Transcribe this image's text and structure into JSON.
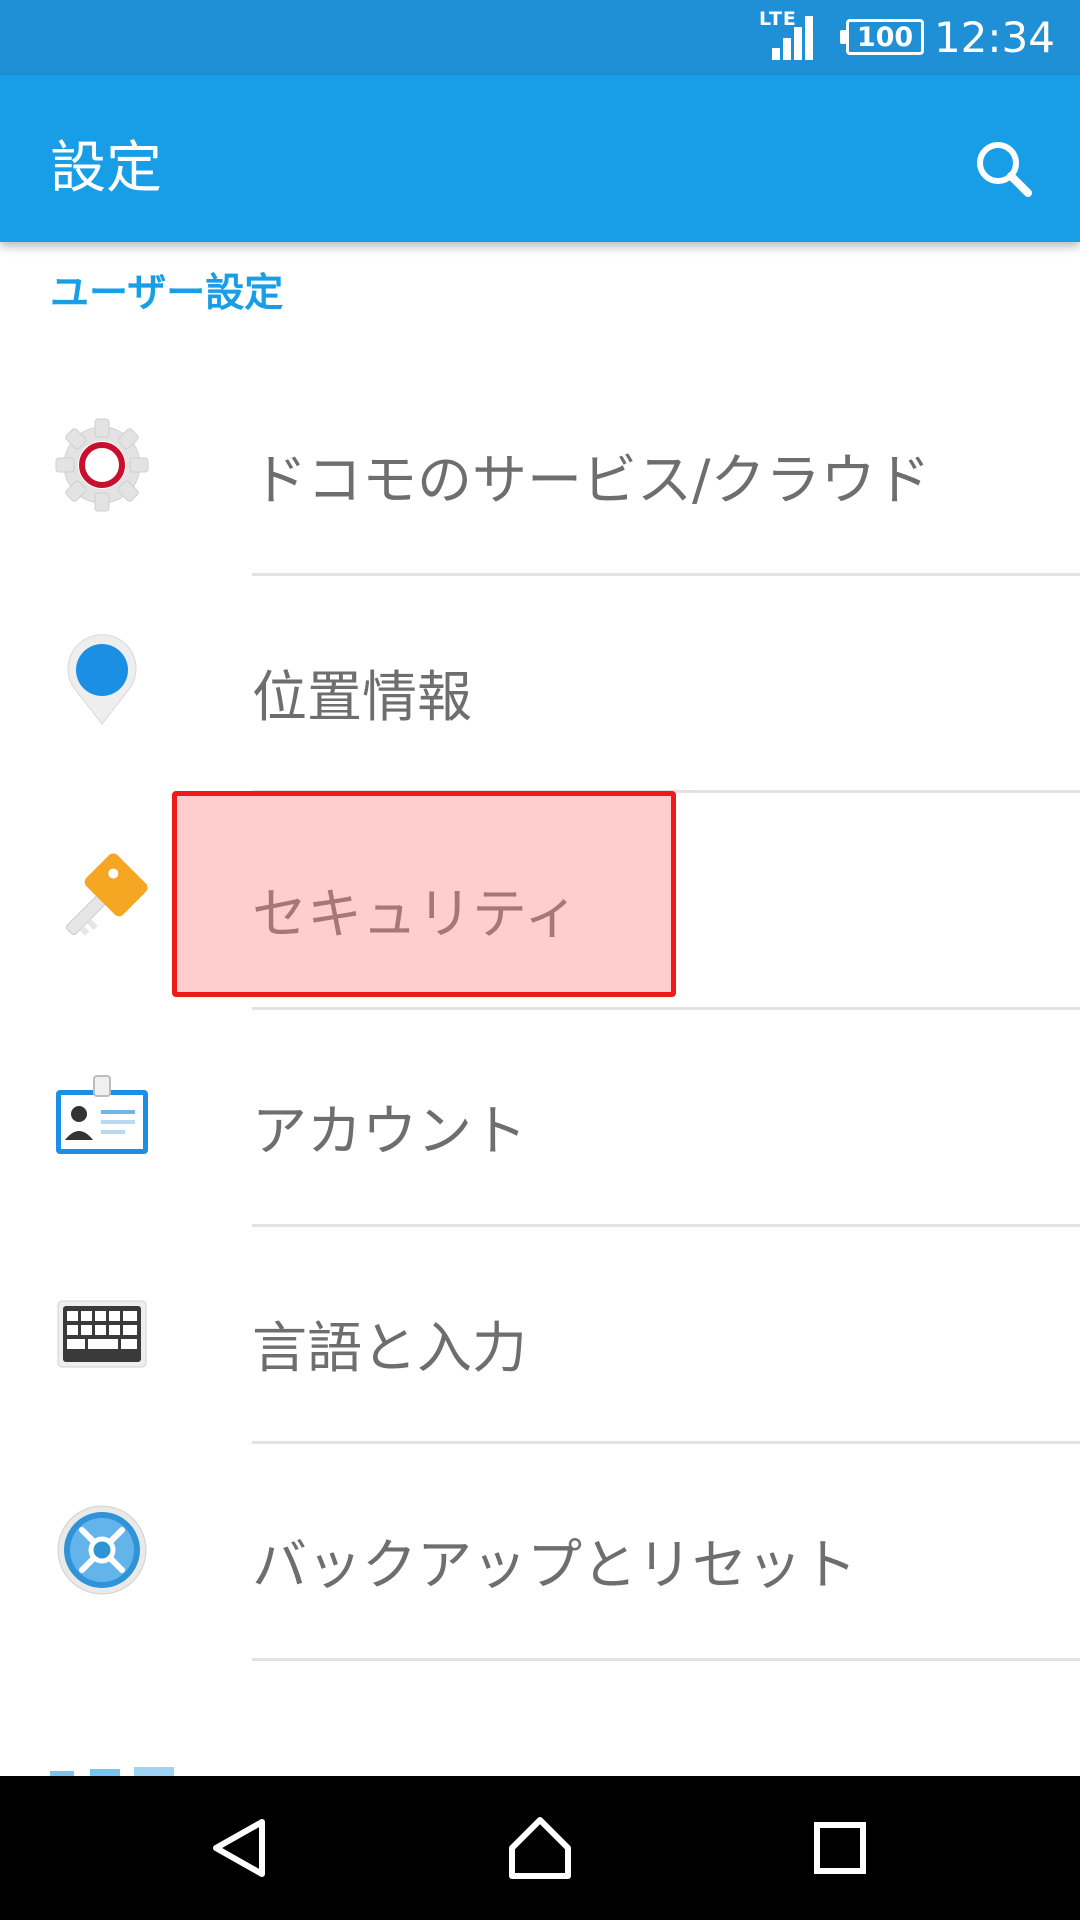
{
  "status_bar": {
    "network": "LTE",
    "battery": "100",
    "time": "12:34"
  },
  "app_bar": {
    "title": "設定",
    "search_icon": "search-icon"
  },
  "section": {
    "header": "ユーザー設定"
  },
  "settings_items": [
    {
      "label": "ドコモのサービス/クラウド",
      "icon": "docomo-gear-icon"
    },
    {
      "label": "位置情報",
      "icon": "location-pin-icon"
    },
    {
      "label": "セキュリティ",
      "icon": "key-icon"
    },
    {
      "label": "アカウント",
      "icon": "id-card-icon"
    },
    {
      "label": "言語と入力",
      "icon": "keyboard-icon"
    },
    {
      "label": "バックアップとリセット",
      "icon": "backup-reset-icon"
    }
  ],
  "highlight": {
    "target": "セキュリティ",
    "color": "#f01a1a"
  },
  "nav_bar": {
    "back_icon": "back-triangle-icon",
    "home_icon": "home-icon",
    "recents_icon": "recents-square-icon"
  },
  "colors": {
    "status_bar": "#1f8fd6",
    "app_bar": "#179ee6",
    "accent": "#179ee6",
    "item_text": "#6e6e6e"
  }
}
